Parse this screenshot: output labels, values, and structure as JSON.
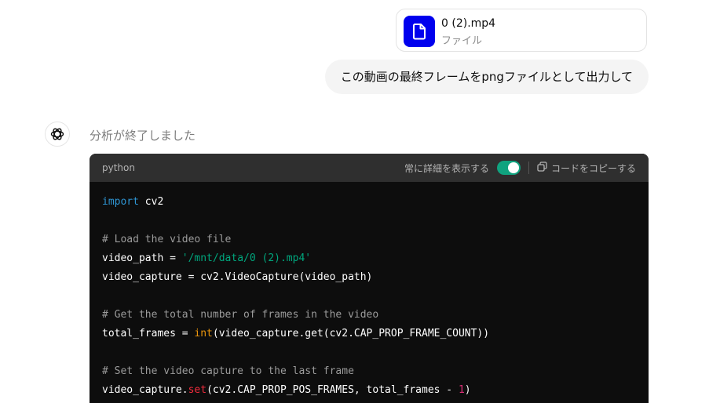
{
  "attachment": {
    "filename": "0 (2).mp4",
    "filetype": "ファイル",
    "icon": "file-icon",
    "icon_bg": "#0000ee"
  },
  "user_message": "この動画の最終フレームをpngファイルとして出力して",
  "assistant": {
    "status": "分析が終了しました",
    "avatar_icon": "openai-logo-icon"
  },
  "code_block": {
    "language": "python",
    "always_show_label": "常に詳細を表示する",
    "toggle_on": true,
    "toggle_color": "#10a37f",
    "copy_label": "コードをコピーする",
    "lines": [
      [
        {
          "t": "import",
          "c": "kw"
        },
        {
          "t": " cv2",
          "c": ""
        }
      ],
      [],
      [
        {
          "t": "# Load the video file",
          "c": "cm"
        }
      ],
      [
        {
          "t": "video_path = ",
          "c": ""
        },
        {
          "t": "'/mnt/data/0 (2).mp4'",
          "c": "str"
        }
      ],
      [
        {
          "t": "video_capture = cv2.VideoCapture(video_path)",
          "c": ""
        }
      ],
      [],
      [
        {
          "t": "# Get the total number of frames in the video",
          "c": "cm"
        }
      ],
      [
        {
          "t": "total_frames = ",
          "c": ""
        },
        {
          "t": "int",
          "c": "bi"
        },
        {
          "t": "(video_capture.get(cv2.CAP_PROP_FRAME_COUNT))",
          "c": ""
        }
      ],
      [],
      [
        {
          "t": "# Set the video capture to the last frame",
          "c": "cm"
        }
      ],
      [
        {
          "t": "video_capture.",
          "c": ""
        },
        {
          "t": "set",
          "c": "fn"
        },
        {
          "t": "(cv2.CAP_PROP_POS_FRAMES, total_frames - ",
          "c": ""
        },
        {
          "t": "1",
          "c": "num"
        },
        {
          "t": ")",
          "c": ""
        }
      ]
    ]
  }
}
